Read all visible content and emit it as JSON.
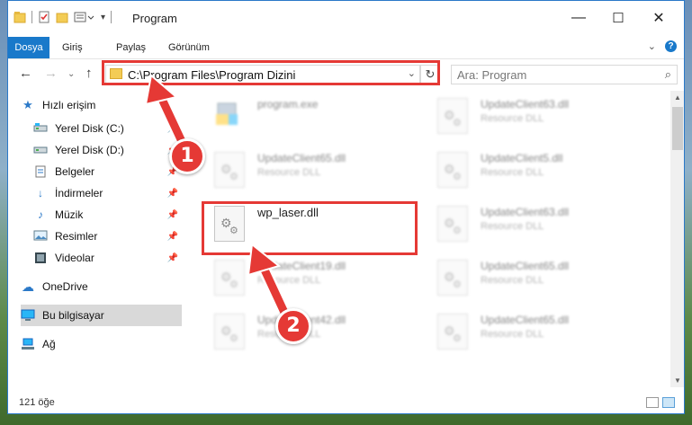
{
  "window": {
    "title": "Program",
    "controls": {
      "minimize": "—",
      "maximize": "☐",
      "close": "✕"
    }
  },
  "ribbon": {
    "tabs": [
      "Dosya",
      "Giriş",
      "Paylaş",
      "Görünüm"
    ],
    "help": "?"
  },
  "address": {
    "path": "C:\\Program Files\\Program Dizini",
    "search_placeholder": "Ara: Program"
  },
  "sidebar": {
    "items": [
      {
        "label": "Hızlı erişim",
        "icon": "star-icon",
        "pinned": false
      },
      {
        "label": "Yerel Disk (C:)",
        "icon": "drive-icon",
        "pinned": true
      },
      {
        "label": "Yerel Disk (D:)",
        "icon": "drive-icon",
        "pinned": true
      },
      {
        "label": "Belgeler",
        "icon": "documents-icon",
        "pinned": true
      },
      {
        "label": "İndirmeler",
        "icon": "download-icon",
        "pinned": true
      },
      {
        "label": "Müzik",
        "icon": "music-icon",
        "pinned": true
      },
      {
        "label": "Resimler",
        "icon": "pictures-icon",
        "pinned": true
      },
      {
        "label": "Videolar",
        "icon": "video-icon",
        "pinned": true
      },
      {
        "label": "OneDrive",
        "icon": "onedrive-icon",
        "pinned": false
      },
      {
        "label": "Bu bilgisayar",
        "icon": "computer-icon",
        "pinned": false,
        "selected": true
      },
      {
        "label": "Ağ",
        "icon": "network-icon",
        "pinned": false
      }
    ]
  },
  "files": [
    {
      "name": "program.exe",
      "type": "",
      "kind": "exe"
    },
    {
      "name": "UpdateClient63.dll",
      "type": "Resource DLL",
      "kind": "dll"
    },
    {
      "name": "UpdateClient65.dll",
      "type": "Resource DLL",
      "kind": "dll"
    },
    {
      "name": "UpdateClient5.dll",
      "type": "Resource DLL",
      "kind": "dll"
    },
    {
      "name": "wp_laser.dll",
      "type": "",
      "kind": "dll",
      "highlighted": true
    },
    {
      "name": "UpdateClient63.dll",
      "type": "Resource DLL",
      "kind": "dll"
    },
    {
      "name": "UpdateClient19.dll",
      "type": "Resource DLL",
      "kind": "dll"
    },
    {
      "name": "UpdateClient65.dll",
      "type": "Resource DLL",
      "kind": "dll"
    },
    {
      "name": "UpdateClient42.dll",
      "type": "Resource DLL",
      "kind": "dll"
    },
    {
      "name": "UpdateClient65.dll",
      "type": "Resource DLL",
      "kind": "dll"
    }
  ],
  "status": {
    "item_count": "121 öğe"
  },
  "annotations": {
    "step1": "1",
    "step2": "2",
    "color": "#e53935"
  }
}
